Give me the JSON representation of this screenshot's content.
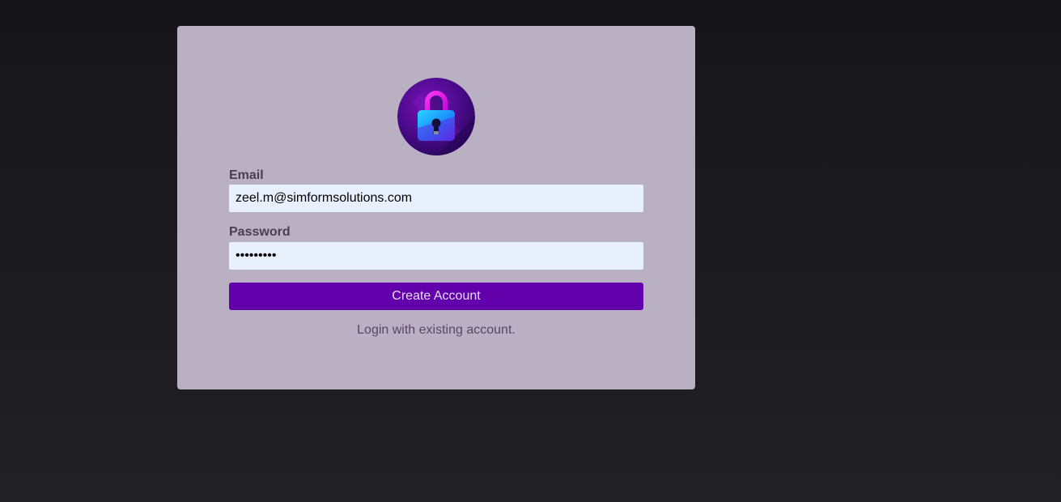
{
  "logo": {
    "icon": "padlock-icon"
  },
  "form": {
    "email_label": "Email",
    "email_value": "zeel.m@simformsolutions.com",
    "password_label": "Password",
    "password_value": "•••••••••",
    "submit_label": "Create Account",
    "alt_link": "Login with existing account."
  },
  "colors": {
    "page_background": "#1c1c1e",
    "card_background": "#bab0c3",
    "input_background": "#e8f0fe",
    "button_background": "#6200ab",
    "link_text": "#5a4568"
  }
}
